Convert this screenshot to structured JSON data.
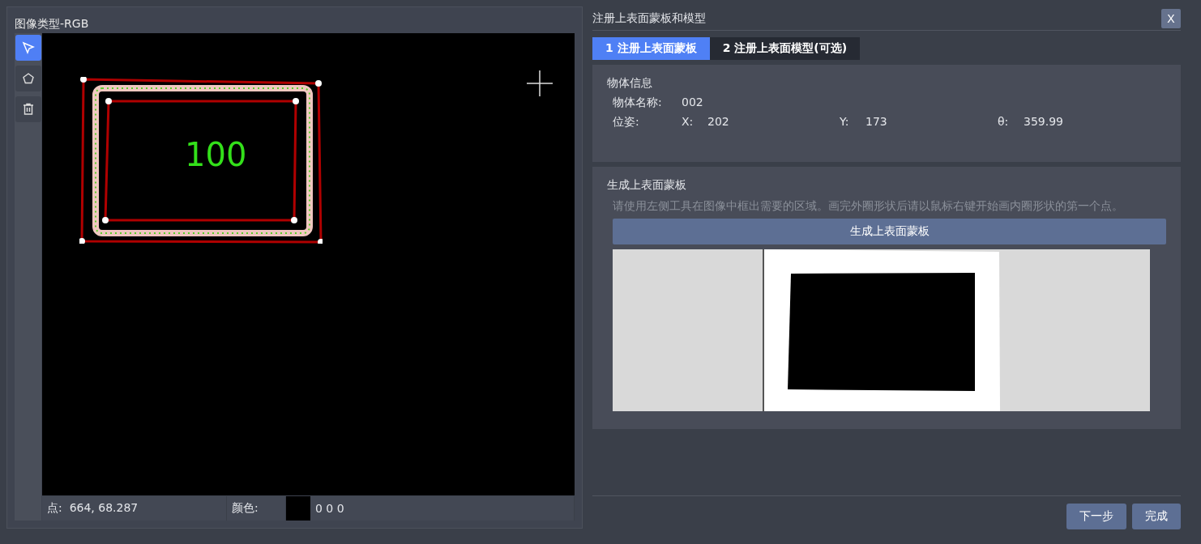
{
  "image_panel": {
    "title": "图像类型-RGB",
    "tools": [
      {
        "kind": "select",
        "selected": true
      },
      {
        "kind": "polygon",
        "selected": false
      },
      {
        "kind": "delete",
        "selected": false
      }
    ],
    "canvas": {
      "label": "100"
    },
    "status": {
      "point_label": "点:",
      "point_value": "664, 68.287",
      "color_label": "颜色:",
      "color_value": "0 0 0",
      "swatch": {
        "color": "#000000"
      }
    }
  },
  "dialog": {
    "title": "注册上表面蒙板和模型",
    "close": "X",
    "tabs": [
      {
        "label": "1 注册上表面蒙板",
        "selected": true
      },
      {
        "label": "2 注册上表面模型(可选)",
        "selected": false
      }
    ],
    "object_info": {
      "heading": "物体信息",
      "name_label": "物体名称:",
      "name_value": "002",
      "pose_label": "位姿:",
      "pose": [
        {
          "label": "X:",
          "value": "202"
        },
        {
          "label": "Y:",
          "value": "173"
        },
        {
          "label": "θ:",
          "value": "359.99"
        }
      ]
    },
    "mask": {
      "heading": "生成上表面蒙板",
      "hint": "请使用左侧工具在图像中框出需要的区域。画完外圈形状后请以鼠标右键开始画内圈形状的第一个点。",
      "button": "生成上表面蒙板"
    },
    "buttons": [
      "下一步",
      "完成"
    ]
  }
}
